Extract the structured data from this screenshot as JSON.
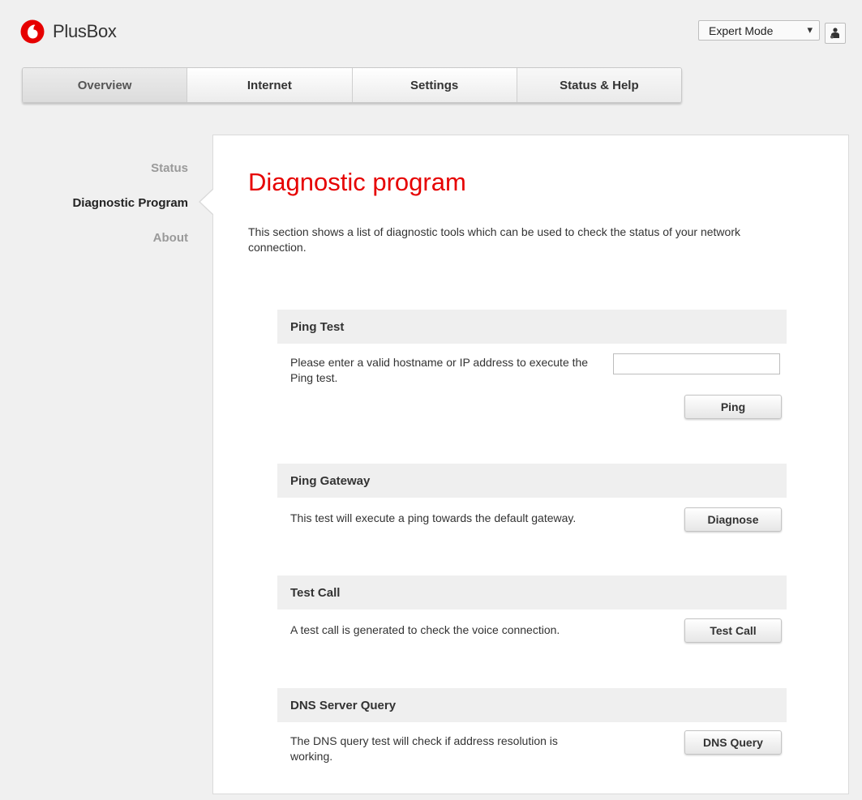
{
  "header": {
    "app_name": "PlusBox",
    "mode_select": {
      "selected": "Expert Mode",
      "arrow": "▾"
    },
    "brand_color": "#e60000"
  },
  "nav": {
    "tabs": [
      {
        "label": "Overview"
      },
      {
        "label": "Internet"
      },
      {
        "label": "Settings"
      },
      {
        "label": "Status & Help"
      }
    ]
  },
  "sidebar": {
    "items": [
      {
        "label": "Status"
      },
      {
        "label": "Diagnostic Program"
      },
      {
        "label": "About"
      }
    ]
  },
  "main": {
    "title": "Diagnostic program",
    "intro": "This section shows a list of diagnostic tools which can be used to check the status of your network connection.",
    "sections": [
      {
        "title": "Ping Test",
        "description": "Please enter a valid hostname or IP address to execute the Ping test.",
        "input_value": "",
        "button": "Ping"
      },
      {
        "title": "Ping Gateway",
        "description": "This test will execute a ping towards the default gateway.",
        "button": "Diagnose"
      },
      {
        "title": "Test Call",
        "description": "A test call is generated to check the voice connection.",
        "button": "Test Call"
      },
      {
        "title": "DNS Server Query",
        "description": "The DNS query test will check if address resolution is working.",
        "button": "DNS Query"
      }
    ]
  }
}
